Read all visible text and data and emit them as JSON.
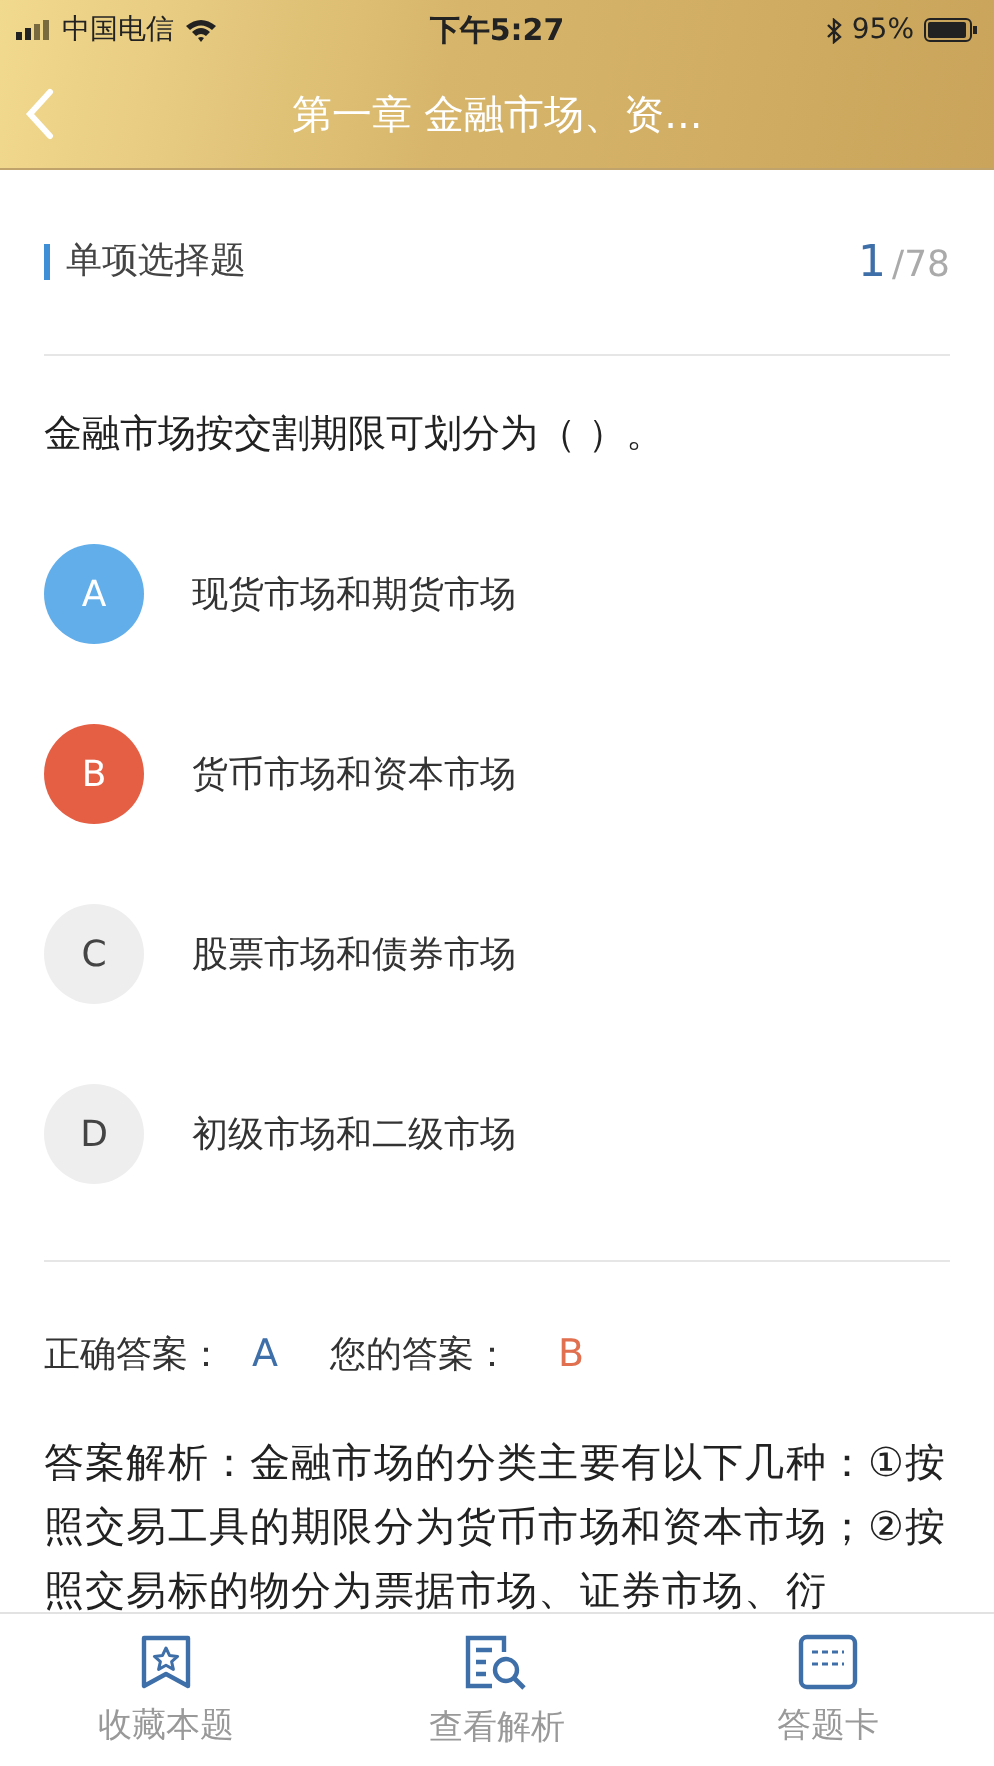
{
  "status_bar": {
    "carrier": "中国电信",
    "time": "下午5:27",
    "battery": "95%"
  },
  "nav": {
    "title": "第一章 金融市场、资..."
  },
  "section": {
    "title": "单项选择题",
    "current": "1",
    "total": "/78"
  },
  "question": "金融市场按交割期限可划分为（ ）。",
  "options": [
    {
      "letter": "A",
      "text": "现货市场和期货市场",
      "correct": true,
      "selected": false
    },
    {
      "letter": "B",
      "text": "货币市场和资本市场",
      "correct": false,
      "selected": true
    },
    {
      "letter": "C",
      "text": "股票市场和债券市场",
      "correct": false,
      "selected": false
    },
    {
      "letter": "D",
      "text": "初级市场和二级市场",
      "correct": false,
      "selected": false
    }
  ],
  "answer": {
    "correct_label": "正确答案：",
    "correct_value": "A",
    "your_label": "您的答案：",
    "your_value": "B"
  },
  "explanation": "答案解析：金融市场的分类主要有以下几种：①按照交易工具的期限分为货币市场和资本市场；②按照交易标的物分为票据市场、证券市场、衍",
  "tabs": [
    {
      "kind": "star",
      "label": "收藏本题"
    },
    {
      "kind": "search",
      "label": "查看解析"
    },
    {
      "kind": "card",
      "label": "答题卡"
    }
  ]
}
